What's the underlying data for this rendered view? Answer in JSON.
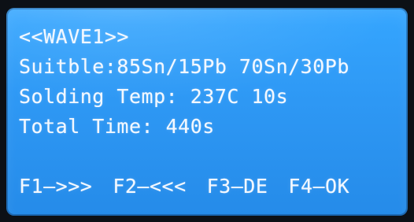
{
  "screen": {
    "title": "<<WAVE1>>",
    "suitable": "Suitble:85Sn/15Pb 70Sn/30Pb",
    "solding_temp": "Solding Temp: 237C 10s",
    "total_time": "Total Time: 440s",
    "function_keys": [
      "F1—>>>",
      "F2—<<<",
      "F3—DE",
      "F4—OK"
    ]
  },
  "colors": {
    "background": "#2e98f4",
    "text": "#f3f8ff",
    "bezel": "#0c1016"
  }
}
